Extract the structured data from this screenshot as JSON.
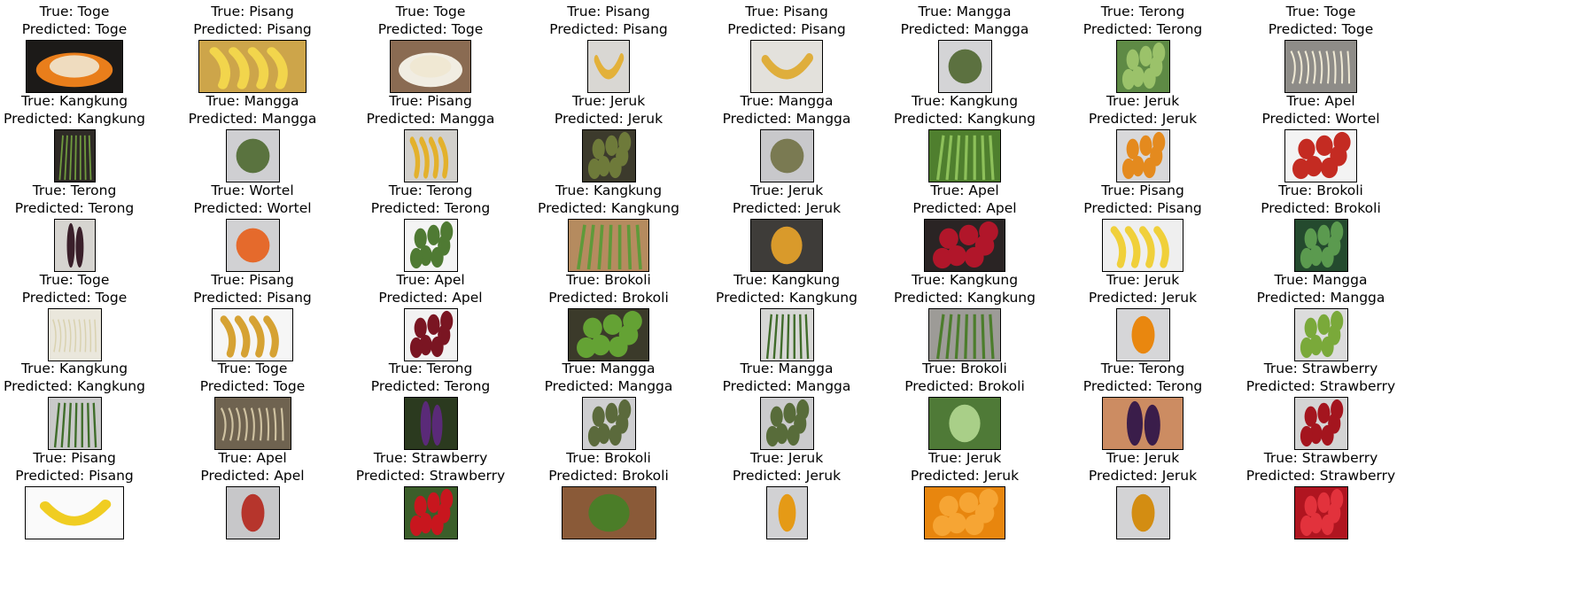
{
  "grid": {
    "columns": 8,
    "rows": [
      [
        {
          "true": "True: Toge",
          "predicted": "Predicted: Toge",
          "icon": "bean-sprouts-plate-image",
          "w": 110,
          "bg": "#1c1a18",
          "fg": "#e97e1b",
          "shape": "plate"
        },
        {
          "true": "True: Pisang",
          "predicted": "Predicted: Pisang",
          "icon": "banana-bunch-image",
          "w": 122,
          "bg": "#cda54a",
          "fg": "#f2d54c",
          "shape": "bananas"
        },
        {
          "true": "True: Toge",
          "predicted": "Predicted: Toge",
          "icon": "bean-sprouts-bowl-image",
          "w": 92,
          "bg": "#8a6b52",
          "fg": "#f1ede2",
          "shape": "plate"
        },
        {
          "true": "True: Pisang",
          "predicted": "Predicted: Pisang",
          "icon": "banana-on-floor-image",
          "w": 48,
          "bg": "#d9d7d3",
          "fg": "#e3b13a",
          "shape": "banana"
        },
        {
          "true": "True: Pisang",
          "predicted": "Predicted: Pisang",
          "icon": "banana-on-tiles-image",
          "w": 82,
          "bg": "#e3e1dc",
          "fg": "#dfae3c",
          "shape": "banana"
        },
        {
          "true": "True: Mangga",
          "predicted": "Predicted: Mangga",
          "icon": "mango-image",
          "w": 61,
          "bg": "#d4d4d6",
          "fg": "#5c7140",
          "shape": "oval"
        },
        {
          "true": "True: Terong",
          "predicted": "Predicted: Terong",
          "icon": "green-eggplants-image",
          "w": 61,
          "bg": "#5e8a45",
          "fg": "#9bc26a",
          "shape": "cluster"
        },
        {
          "true": "True: Toge",
          "predicted": "Predicted: Toge",
          "icon": "single-sprout-image",
          "w": 82,
          "bg": "#8e8c88",
          "fg": "#efe9d4",
          "shape": "sprout"
        }
      ],
      [
        {
          "true": "True: Kangkung",
          "predicted": "Predicted: Kangkung",
          "icon": "water-spinach-image",
          "w": 47,
          "bg": "#2e2a26",
          "fg": "#6f9a3e",
          "shape": "stems"
        },
        {
          "true": "True: Mangga",
          "predicted": "Predicted: Mangga",
          "icon": "mango-image",
          "w": 61,
          "bg": "#cfcfd2",
          "fg": "#5a733f",
          "shape": "oval"
        },
        {
          "true": "True: Pisang",
          "predicted": "Predicted: Mangga",
          "icon": "bananas-image",
          "w": 61,
          "bg": "#d2d0cc",
          "fg": "#e3b12c",
          "shape": "bananas"
        },
        {
          "true": "True: Jeruk",
          "predicted": "Predicted: Jeruk",
          "icon": "oranges-image",
          "w": 61,
          "bg": "#3c3a2c",
          "fg": "#6e7a3a",
          "shape": "cluster"
        },
        {
          "true": "True: Mangga",
          "predicted": "Predicted: Mangga",
          "icon": "mango-image",
          "w": 61,
          "bg": "#c8c8cb",
          "fg": "#7a7a52",
          "shape": "oval"
        },
        {
          "true": "True: Kangkung",
          "predicted": "Predicted: Kangkung",
          "icon": "water-spinach-image",
          "w": 82,
          "bg": "#4f7f2e",
          "fg": "#8dc05a",
          "shape": "stems"
        },
        {
          "true": "True: Jeruk",
          "predicted": "Predicted: Jeruk",
          "icon": "orange-image",
          "w": 61,
          "bg": "#d8d8da",
          "fg": "#e48a1e",
          "shape": "cluster"
        },
        {
          "true": "True: Apel",
          "predicted": "Predicted: Wortel",
          "icon": "red-apples-image",
          "w": 82,
          "bg": "#f3f3f3",
          "fg": "#c42b22",
          "shape": "cluster"
        }
      ],
      [
        {
          "true": "True: Terong",
          "predicted": "Predicted: Terong",
          "icon": "eggplant-image",
          "w": 47,
          "bg": "#d6d4d0",
          "fg": "#3a1f2a",
          "shape": "long"
        },
        {
          "true": "True: Wortel",
          "predicted": "Predicted: Wortel",
          "icon": "carrot-image",
          "w": 61,
          "bg": "#d1d1d3",
          "fg": "#e56a2c",
          "shape": "oval"
        },
        {
          "true": "True: Terong",
          "predicted": "Predicted: Terong",
          "icon": "round-eggplants-image",
          "w": 61,
          "bg": "#f4f4f4",
          "fg": "#4f7a33",
          "shape": "cluster"
        },
        {
          "true": "True: Kangkung",
          "predicted": "Predicted: Kangkung",
          "icon": "water-spinach-bunch-image",
          "w": 92,
          "bg": "#b58b5f",
          "fg": "#5f9a3a",
          "shape": "stems"
        },
        {
          "true": "True: Jeruk",
          "predicted": "Predicted: Jeruk",
          "icon": "orange-image",
          "w": 82,
          "bg": "#3e3c39",
          "fg": "#d99a2b",
          "shape": "round"
        },
        {
          "true": "True: Apel",
          "predicted": "Predicted: Apel",
          "icon": "red-apples-image",
          "w": 92,
          "bg": "#2a2424",
          "fg": "#b1162a",
          "shape": "cluster"
        },
        {
          "true": "True: Pisang",
          "predicted": "Predicted: Pisang",
          "icon": "banana-bunch-image",
          "w": 92,
          "bg": "#efefef",
          "fg": "#f0d03a",
          "shape": "bananas"
        },
        {
          "true": "True: Brokoli",
          "predicted": "Predicted: Brokoli",
          "icon": "broccoli-image",
          "w": 61,
          "bg": "#244a2e",
          "fg": "#5b9a4f",
          "shape": "cluster"
        }
      ],
      [
        {
          "true": "True: Toge",
          "predicted": "Predicted: Toge",
          "icon": "bean-sprouts-image",
          "w": 61,
          "bg": "#eae7dc",
          "fg": "#d9d2b0",
          "shape": "sprout"
        },
        {
          "true": "True: Pisang",
          "predicted": "Predicted: Pisang",
          "icon": "small-bananas-image",
          "w": 92,
          "bg": "#f6f6f6",
          "fg": "#d6a233",
          "shape": "bananas"
        },
        {
          "true": "True: Apel",
          "predicted": "Predicted: Apel",
          "icon": "red-apples-image",
          "w": 61,
          "bg": "#f2f2f2",
          "fg": "#7a1522",
          "shape": "cluster"
        },
        {
          "true": "True: Brokoli",
          "predicted": "Predicted: Brokoli",
          "icon": "broccoli-bowl-image",
          "w": 92,
          "bg": "#3b3a2a",
          "fg": "#64a234",
          "shape": "cluster"
        },
        {
          "true": "True: Kangkung",
          "predicted": "Predicted: Kangkung",
          "icon": "water-spinach-image",
          "w": 61,
          "bg": "#d7d7d5",
          "fg": "#3f6b2a",
          "shape": "stems"
        },
        {
          "true": "True: Kangkung",
          "predicted": "Predicted: Kangkung",
          "icon": "water-spinach-image",
          "w": 82,
          "bg": "#9d9b97",
          "fg": "#4c7d2c",
          "shape": "stems"
        },
        {
          "true": "True: Jeruk",
          "predicted": "Predicted: Jeruk",
          "icon": "orange-image",
          "w": 61,
          "bg": "#d6d6d8",
          "fg": "#e9870f",
          "shape": "round"
        },
        {
          "true": "True: Mangga",
          "predicted": "Predicted: Mangga",
          "icon": "mangoes-image",
          "w": 61,
          "bg": "#dcdcdc",
          "fg": "#7aa93a",
          "shape": "cluster"
        }
      ],
      [
        {
          "true": "True: Kangkung",
          "predicted": "Predicted: Kangkung",
          "icon": "water-spinach-leaves-image",
          "w": 61,
          "bg": "#c9c9c9",
          "fg": "#3f6d2a",
          "shape": "stems"
        },
        {
          "true": "True: Toge",
          "predicted": "Predicted: Toge",
          "icon": "dried-sprouts-image",
          "w": 87,
          "bg": "#6f6350",
          "fg": "#cfc2a1",
          "shape": "sprout"
        },
        {
          "true": "True: Terong",
          "predicted": "Predicted: Terong",
          "icon": "purple-eggplants-image",
          "w": 61,
          "bg": "#2b3a1f",
          "fg": "#5a2a78",
          "shape": "long"
        },
        {
          "true": "True: Mangga",
          "predicted": "Predicted: Mangga",
          "icon": "mangoes-image",
          "w": 61,
          "bg": "#cfcfd1",
          "fg": "#5b6a3c",
          "shape": "cluster"
        },
        {
          "true": "True: Mangga",
          "predicted": "Predicted: Mangga",
          "icon": "mangoes-image",
          "w": 61,
          "bg": "#cbcbcd",
          "fg": "#586c3a",
          "shape": "cluster"
        },
        {
          "true": "True: Brokoli",
          "predicted": "Predicted: Brokoli",
          "icon": "broccoli-image",
          "w": 82,
          "bg": "#4f7a37",
          "fg": "#a9cf88",
          "shape": "round"
        },
        {
          "true": "True: Terong",
          "predicted": "Predicted: Terong",
          "icon": "eggplants-on-board-image",
          "w": 92,
          "bg": "#cc8c62",
          "fg": "#3a1d4a",
          "shape": "long"
        },
        {
          "true": "True: Strawberry",
          "predicted": "Predicted: Strawberry",
          "icon": "strawberries-image",
          "w": 61,
          "bg": "#d4d4d4",
          "fg": "#a4151e",
          "shape": "cluster"
        }
      ],
      [
        {
          "true": "True: Pisang",
          "predicted": "Predicted: Pisang",
          "icon": "banana-image",
          "w": 112,
          "bg": "#fafafa",
          "fg": "#f0cd22",
          "shape": "banana"
        },
        {
          "true": "True: Apel",
          "predicted": "Predicted: Apel",
          "icon": "apple-image",
          "w": 61,
          "bg": "#c7c7c9",
          "fg": "#b6352c",
          "shape": "round"
        },
        {
          "true": "True: Strawberry",
          "predicted": "Predicted: Strawberry",
          "icon": "strawberries-image",
          "w": 61,
          "bg": "#3b5e2a",
          "fg": "#c8161e",
          "shape": "cluster"
        },
        {
          "true": "True: Brokoli",
          "predicted": "Predicted: Brokoli",
          "icon": "broccoli-bowl-image",
          "w": 107,
          "bg": "#8a5a38",
          "fg": "#4b7d28",
          "shape": "round"
        },
        {
          "true": "True: Jeruk",
          "predicted": "Predicted: Jeruk",
          "icon": "orange-image",
          "w": 47,
          "bg": "#d1d1d3",
          "fg": "#e59a16",
          "shape": "round"
        },
        {
          "true": "True: Jeruk",
          "predicted": "Predicted: Jeruk",
          "icon": "oranges-pile-image",
          "w": 92,
          "bg": "#e8860e",
          "fg": "#f6a534",
          "shape": "cluster"
        },
        {
          "true": "True: Jeruk",
          "predicted": "Predicted: Jeruk",
          "icon": "orange-image",
          "w": 61,
          "bg": "#d3d3d5",
          "fg": "#d38d12",
          "shape": "round"
        },
        {
          "true": "True: Strawberry",
          "predicted": "Predicted: Strawberry",
          "icon": "strawberries-image",
          "w": 61,
          "bg": "#b01520",
          "fg": "#e2323c",
          "shape": "cluster"
        }
      ]
    ]
  }
}
